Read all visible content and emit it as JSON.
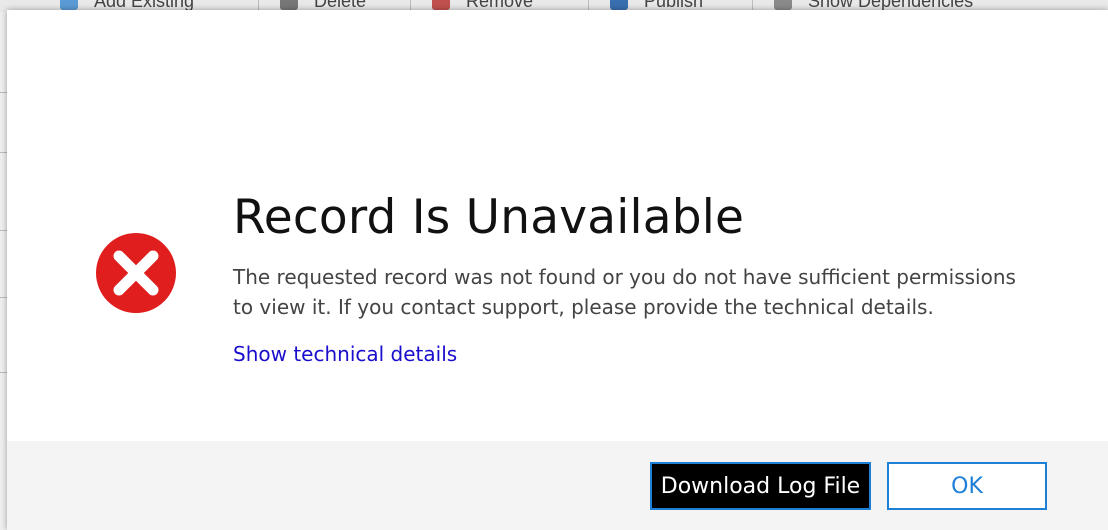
{
  "background_toolbar": {
    "items": [
      {
        "label": "Add Existing",
        "icon": "add-existing-icon"
      },
      {
        "label": "Delete",
        "icon": "delete-icon"
      },
      {
        "label": "Remove",
        "icon": "remove-icon"
      },
      {
        "label": "Publish",
        "icon": "publish-icon"
      },
      {
        "label": "Show Dependencies",
        "icon": "dependencies-icon"
      }
    ]
  },
  "dialog": {
    "icon": "error-icon",
    "title": "Record Is Unavailable",
    "message": "The requested record was not found or you do not have sufficient permissions to view it. If you contact support, please provide the technical details.",
    "link": "Show technical details",
    "buttons": {
      "download": "Download Log File",
      "ok": "OK"
    }
  },
  "colors": {
    "error_red": "#e01e1e",
    "link_blue": "#1a0dcc",
    "accent_blue": "#1e7fd7",
    "footer_bg": "#f4f4f4"
  }
}
